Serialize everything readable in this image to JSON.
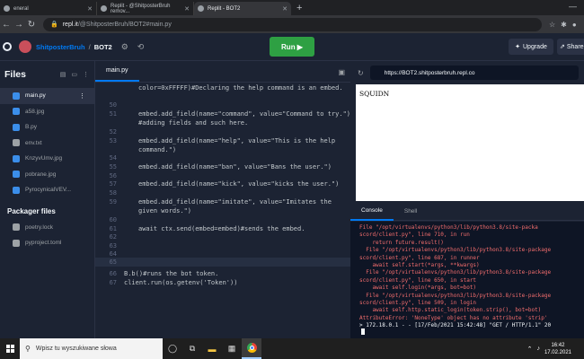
{
  "browser": {
    "tabs": [
      {
        "label": "eneral",
        "active": false
      },
      {
        "label": "Replit - @ShitposterBruh remov...",
        "active": false
      },
      {
        "label": "Replit - BOT2",
        "active": true
      }
    ],
    "url_host": "repl.it",
    "url_path": "/@ShitposterBruh/BOT2#main.py"
  },
  "header": {
    "owner": "ShitposterBruh",
    "separator": "/",
    "repl_name": "BOT2",
    "run_label": "Run ▶",
    "upgrade_label": "Upgrade",
    "share_label": "Share"
  },
  "sidebar": {
    "title": "Files",
    "files": [
      {
        "name": "main.py",
        "color": "#3b8eea",
        "active": true
      },
      {
        "name": "a58.jpg",
        "color": "#3b8eea",
        "active": false
      },
      {
        "name": "B.py",
        "color": "#3b8eea",
        "active": false
      },
      {
        "name": "env.txt",
        "color": "#9da2a6",
        "active": false
      },
      {
        "name": "KnzyvUmv.jpg",
        "color": "#3b8eea",
        "active": false
      },
      {
        "name": "pobrane.jpg",
        "color": "#3b8eea",
        "active": false
      },
      {
        "name": "PyrocynicalVEV...",
        "color": "#3b8eea",
        "active": false
      }
    ],
    "packager_title": "Packager files",
    "packager_files": [
      {
        "name": "poetry.lock"
      },
      {
        "name": "pyproject.toml"
      }
    ]
  },
  "editor": {
    "tab": "main.py",
    "lines": [
      {
        "n": "",
        "text": "color=0xFFFFF)#Declaring the help command is an embed."
      },
      {
        "n": "50",
        "text": ""
      },
      {
        "n": "51",
        "text": "embed.add_field(name=\"command\", value=\"Command to try.\")"
      },
      {
        "n": "",
        "text": "#adding fields and such here."
      },
      {
        "n": "52",
        "text": ""
      },
      {
        "n": "53",
        "text": "embed.add_field(name=\"help\", value=\"This is the help"
      },
      {
        "n": "",
        "text": "command.\")"
      },
      {
        "n": "54",
        "text": ""
      },
      {
        "n": "55",
        "text": "embed.add_field(name=\"ban\", value=\"Bans the user.\")"
      },
      {
        "n": "56",
        "text": ""
      },
      {
        "n": "57",
        "text": "embed.add_field(name=\"kick\", value=\"kicks the user.\")"
      },
      {
        "n": "58",
        "text": ""
      },
      {
        "n": "59",
        "text": "embed.add_field(name=\"imitate\", value=\"Imitates the"
      },
      {
        "n": "",
        "text": "given words.\")"
      },
      {
        "n": "60",
        "text": ""
      },
      {
        "n": "61",
        "text": "await ctx.send(embed=embed)#sends the embed."
      },
      {
        "n": "62",
        "text": ""
      },
      {
        "n": "63",
        "text": ""
      },
      {
        "n": "64",
        "text": ""
      },
      {
        "n": "65",
        "text": ""
      },
      {
        "n": "66",
        "text": "B.b()#runs the bot token."
      },
      {
        "n": "67",
        "text": "client.run(os.getenv('Token'))"
      }
    ]
  },
  "webview": {
    "url": "https://BOT2.shitposterbruh.repl.co",
    "content": "SQUIDN"
  },
  "console": {
    "tabs": [
      "Console",
      "Shell"
    ],
    "lines": [
      "File \"/opt/virtualenvs/python3/lib/python3.8/site-packa",
      "scord/client.py\", line 710, in run",
      "    return future.result()",
      "  File \"/opt/virtualenvs/python3/lib/python3.8/site-package",
      "scord/client.py\", line 687, in runner",
      "    await self.start(*args, **kwargs)",
      "  File \"/opt/virtualenvs/python3/lib/python3.8/site-package",
      "scord/client.py\", line 650, in start",
      "    await self.login(*args, bot=bot)",
      "  File \"/opt/virtualenvs/python3/lib/python3.8/site-package",
      "scord/client.py\", line 509, in login",
      "    await self.http.static_login(token.strip(), bot=bot)",
      "AttributeError: 'NoneType' object has no attribute 'strip'",
      "> 172.18.0.1 - - [17/Feb/2021 15:42:48] \"GET / HTTP/1.1\" 20"
    ]
  },
  "taskbar": {
    "search_placeholder": "Wpisz tu wyszukiwane słowa",
    "time": "16:42",
    "date": "17.02.2021"
  }
}
